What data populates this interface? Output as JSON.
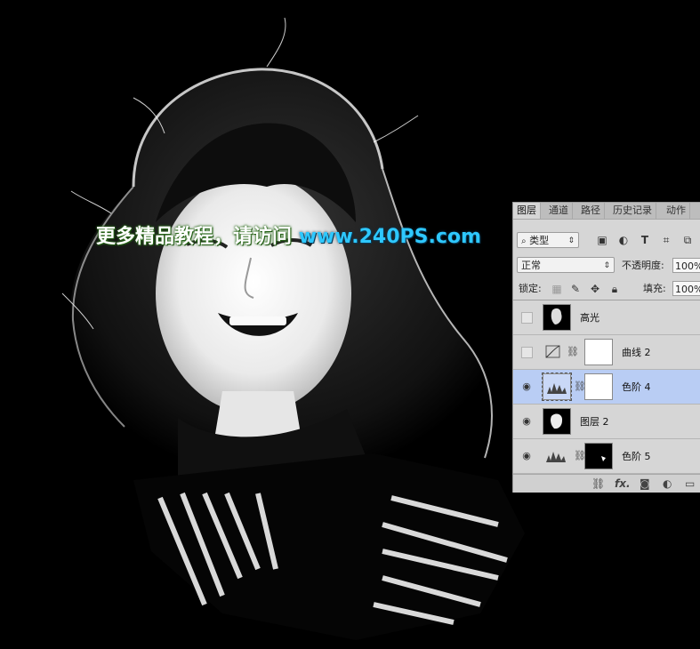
{
  "watermark": {
    "text_cn": "更多精品教程，请访问",
    "url": "www.240PS.com"
  },
  "panel": {
    "tabs": [
      "图层",
      "通道",
      "路径",
      "历史记录",
      "动作"
    ],
    "active_tab": "图层",
    "filter_dropdown": "类型",
    "filter_icons": [
      "image-filter-icon",
      "adjustment-filter-icon",
      "type-filter-icon",
      "shape-filter-icon",
      "smart-object-filter-icon"
    ],
    "blend_mode": "正常",
    "opacity_label": "不透明度:",
    "opacity_value": "100%",
    "lock_label": "锁定:",
    "fill_label": "填充:",
    "fill_value": "100%",
    "layers": [
      {
        "name": "高光",
        "visible": false,
        "selected": false
      },
      {
        "name": "曲线 2",
        "visible": false,
        "selected": false
      },
      {
        "name": "色阶 4",
        "visible": true,
        "selected": true
      },
      {
        "name": "图层 2",
        "visible": true,
        "selected": false
      },
      {
        "name": "色阶 5",
        "visible": true,
        "selected": false
      }
    ],
    "bottom_icons": [
      "link-icon",
      "fx-icon",
      "mask-icon",
      "adjustment-icon",
      "folder-icon"
    ],
    "bottom_fx": "fx."
  },
  "colors": {
    "canvas_bg": "#000000",
    "panel_bg": "#d6d6d6",
    "selected_layer": "#b9cdf4",
    "watermark_url": "#2ec8ff"
  }
}
